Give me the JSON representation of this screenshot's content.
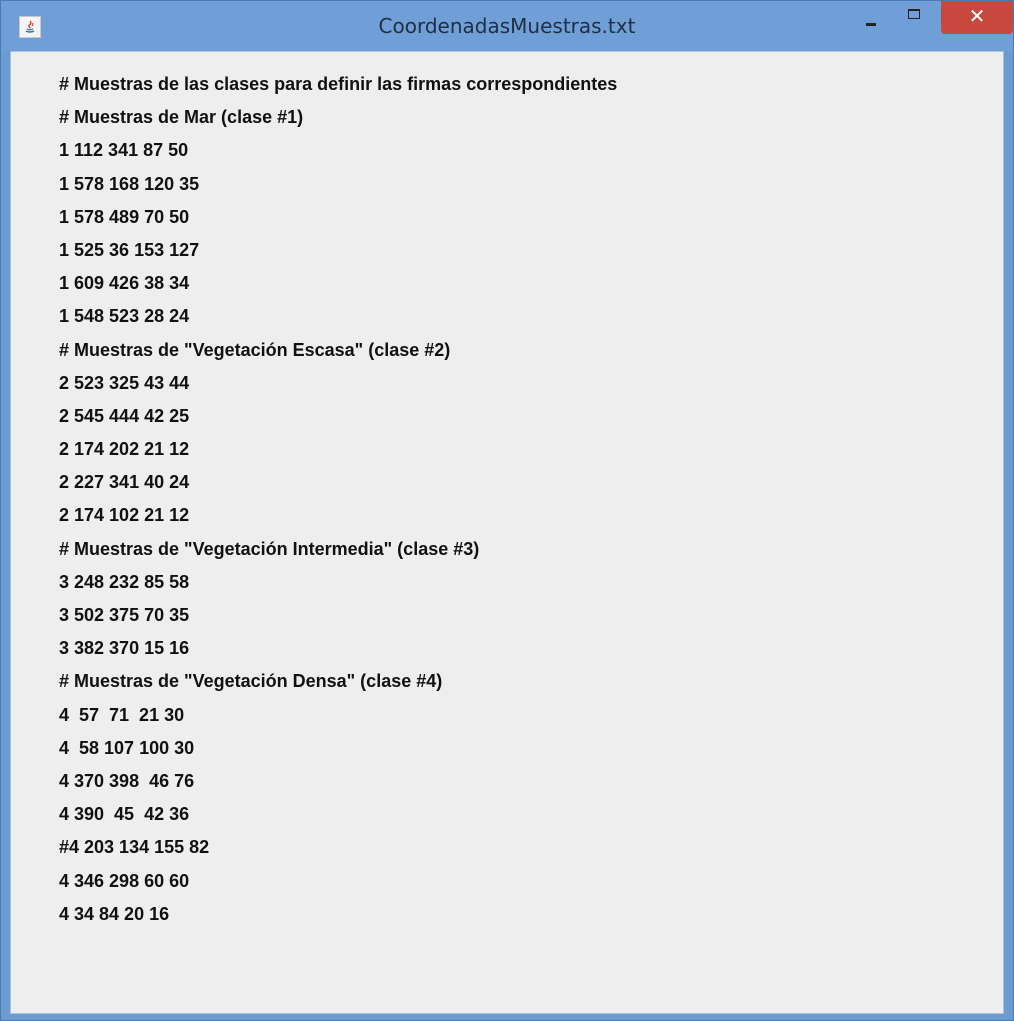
{
  "window": {
    "title": "CoordenadasMuestras.txt",
    "icon": "java-icon",
    "controls": {
      "minimize": "minimize-icon",
      "maximize": "maximize-icon",
      "close": "✕"
    },
    "colors": {
      "titlebar": "#6f9fd6",
      "close": "#c7493e",
      "content": "#eeeeee"
    }
  },
  "content": {
    "lines": [
      "# Muestras de las clases para definir las firmas correspondientes",
      "# Muestras de Mar (clase #1)",
      "1 112 341 87 50",
      "1 578 168 120 35",
      "1 578 489 70 50",
      "1 525 36 153 127",
      "1 609 426 38 34",
      "1 548 523 28 24",
      "# Muestras de \"Vegetación Escasa\" (clase #2)",
      "2 523 325 43 44",
      "2 545 444 42 25",
      "2 174 202 21 12",
      "2 227 341 40 24",
      "2 174 102 21 12",
      "# Muestras de \"Vegetación Intermedia\" (clase #3)",
      "3 248 232 85 58",
      "3 502 375 70 35",
      "3 382 370 15 16",
      "# Muestras de \"Vegetación Densa\" (clase #4)",
      "4  57  71  21 30",
      "4  58 107 100 30",
      "4 370 398  46 76",
      "4 390  45  42 36",
      "#4 203 134 155 82",
      "4 346 298 60 60",
      "4 34 84 20 16"
    ]
  }
}
